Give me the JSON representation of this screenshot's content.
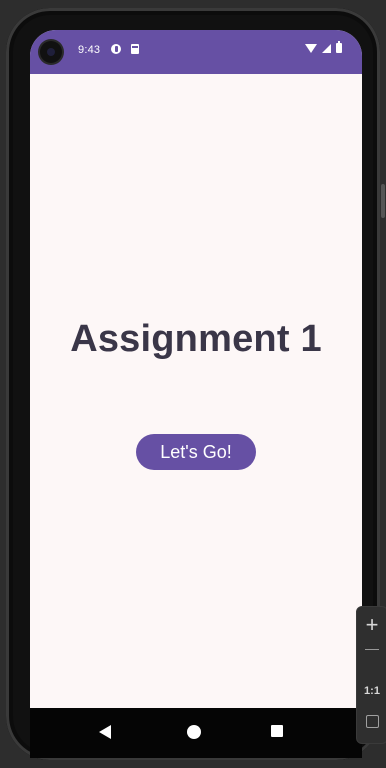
{
  "status_bar": {
    "time": "9:43"
  },
  "main": {
    "title": "Assignment 1",
    "button_label": "Let's Go!"
  },
  "emulator_zoom": {
    "zoom_in": "+",
    "reset_label": "1:1"
  },
  "colors": {
    "primary": "#6650a4",
    "background": "#fdf7f7",
    "title_text": "#3a3648",
    "navigation_bar": "#050505"
  }
}
